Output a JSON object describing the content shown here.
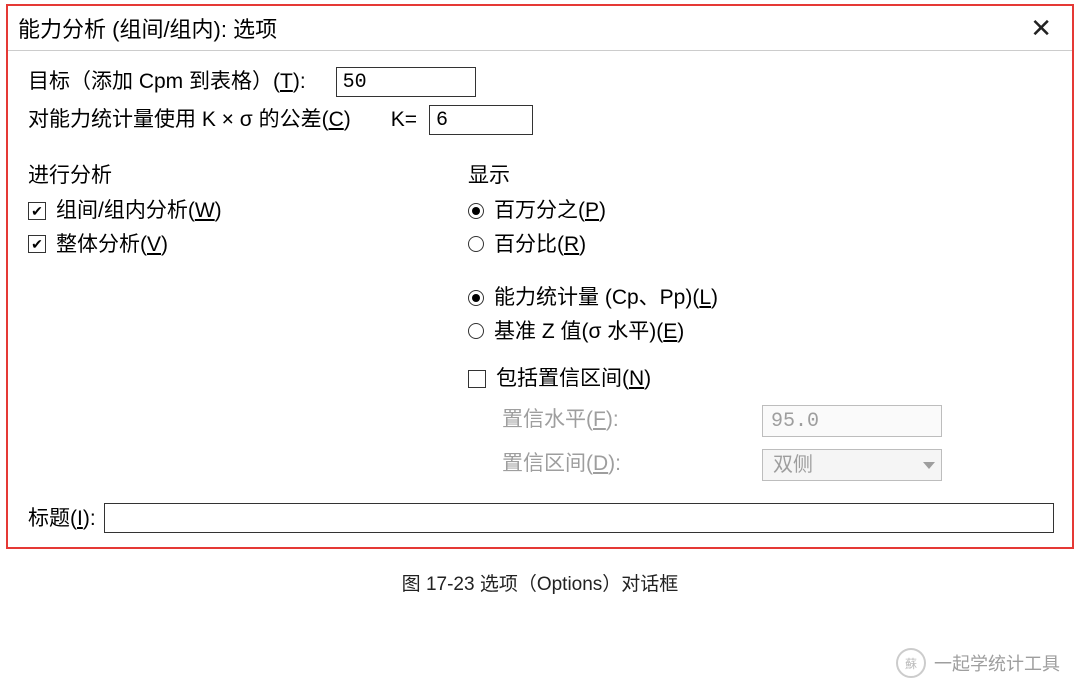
{
  "window": {
    "title": "能力分析 (组间/组内): 选项"
  },
  "form": {
    "target_label_pre": "目标（添加 Cpm 到表格）(",
    "target_mn": "T",
    "target_label_post": "):",
    "target_value": "50",
    "tolerance_label_pre": "对能力统计量使用 K × σ 的公差(",
    "tolerance_mn": "C",
    "tolerance_label_post": ")",
    "k_label": "K=",
    "k_value": "6"
  },
  "analysis": {
    "title": "进行分析",
    "between_within_pre": "组间/组内分析(",
    "between_within_mn": "W",
    "between_within_post": ")",
    "between_within_checked": true,
    "overall_pre": "整体分析(",
    "overall_mn": "V",
    "overall_post": ")",
    "overall_checked": true
  },
  "display": {
    "title": "显示",
    "ppm_pre": "百万分之(",
    "ppm_mn": "P",
    "ppm_post": ")",
    "ppm_selected": true,
    "percent_pre": "百分比(",
    "percent_mn": "R",
    "percent_post": ")",
    "percent_selected": false,
    "cap_pre": "能力统计量 (Cp、Pp)(",
    "cap_mn": "L",
    "cap_post": ")",
    "cap_selected": true,
    "bench_pre": "基准 Z 值(σ 水平)(",
    "bench_mn": "E",
    "bench_post": ")",
    "bench_selected": false,
    "ci_pre": "包括置信区间(",
    "ci_mn": "N",
    "ci_post": ")",
    "ci_checked": false,
    "conf_level_pre": "置信水平(",
    "conf_level_mn": "F",
    "conf_level_post": "):",
    "conf_level_value": "95.0",
    "conf_interval_pre": "置信区间(",
    "conf_interval_mn": "D",
    "conf_interval_post": "):",
    "conf_interval_value": "双侧"
  },
  "title_row": {
    "label_pre": "标题(",
    "label_mn": "I",
    "label_post": "):",
    "value": ""
  },
  "caption": "图 17-23    选项（Options）对话框",
  "watermark": "一起学统计工具"
}
